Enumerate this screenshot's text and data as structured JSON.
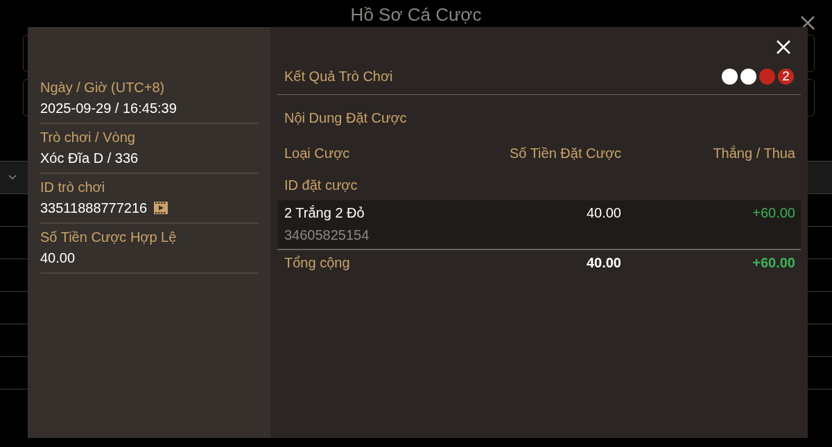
{
  "background_page": {
    "title": "Hồ Sơ Cá Cược"
  },
  "details": {
    "fields": [
      {
        "label": "Ngày / Giờ (UTC+8)",
        "value": "2025-09-29 / 16:45:39",
        "has_replay": false
      },
      {
        "label": "Trò chơi / Vòng",
        "value": "Xóc Đĩa D / 336",
        "has_replay": false
      },
      {
        "label": "ID trò chơi",
        "value": "33511888777216",
        "has_replay": true
      },
      {
        "label": "Số Tiền Cược Hợp Lệ",
        "value": "40.00",
        "has_replay": false
      }
    ]
  },
  "result": {
    "label": "Kết Quả Trò Chơi",
    "dots": [
      {
        "color": "#ffffff"
      },
      {
        "color": "#ffffff"
      },
      {
        "color": "#c0261c"
      }
    ],
    "count": "2"
  },
  "bet_content": {
    "title": "Nội Dung Đặt Cược",
    "columns": [
      "Loại Cược",
      "Số Tiền Đặt Cược",
      "Thắng / Thua"
    ],
    "sub_header": "ID đặt cược",
    "rows": [
      {
        "type": "2 Trắng 2 Đỏ",
        "bet_id": "34605825154",
        "amount": "40.00",
        "win_loss": "+60.00",
        "positive": true
      }
    ],
    "total": {
      "label": "Tổng cộng",
      "amount": "40.00",
      "win_loss": "+60.00",
      "positive": true
    }
  }
}
